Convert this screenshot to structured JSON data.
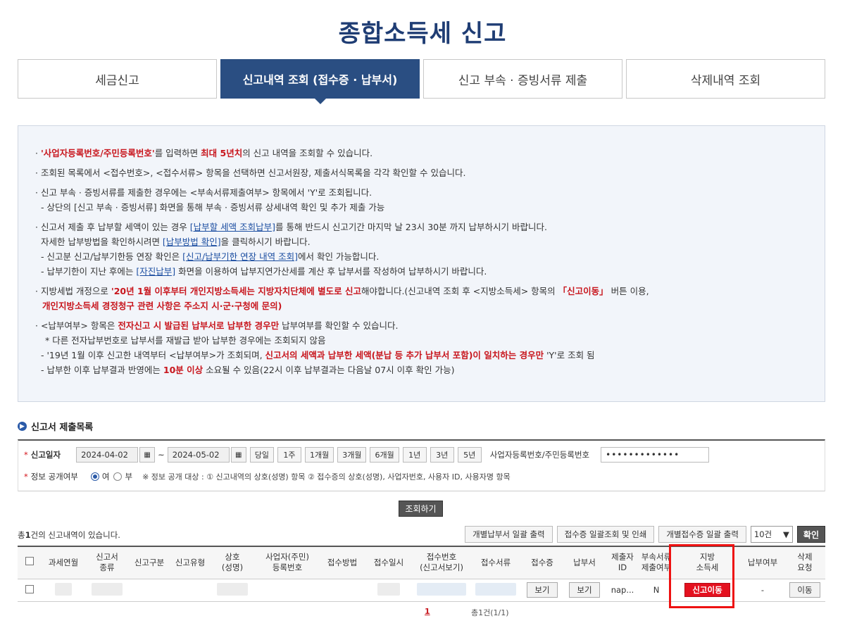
{
  "page": {
    "title": "종합소득세 신고"
  },
  "tabs": [
    {
      "label": "세금신고",
      "active": false
    },
    {
      "label": "신고내역 조회 (접수증 · 납부서)",
      "active": true
    },
    {
      "label": "신고 부속 · 증빙서류 제출",
      "active": false
    },
    {
      "label": "삭제내역 조회",
      "active": false
    }
  ],
  "notice": {
    "l1": {
      "a": "'사업자등록번호/주민등록번호'",
      "b": "를 입력하면 ",
      "c": "최대 5년치",
      "d": "의 신고 내역을 조회할 수 있습니다."
    },
    "l2": "· 조회된 목록에서 <접수번호>, <접수서류> 항목을 선택하면 신고서원장, 제출서식목록을 각각 확인할 수 있습니다.",
    "l3": "· 신고 부속 · 증빙서류를 제출한 경우에는 <부속서류제출여부> 항목에서 'Y'로 조회됩니다.",
    "l4": "- 상단의 [신고 부속 · 증빙서류] 화면을 통해 부속 · 증빙서류 상세내역 확인 및 추가 제출 가능",
    "l5": {
      "a": "· 신고서 제출 후 납부할 세액이 있는 경우 ",
      "link": "[납부할 세액 조회납부]",
      "b": "를 통해 반드시 신고기간 마지막 날 23시 30분 까지 납부하시기 바랍니다."
    },
    "l6": {
      "a": "자세한 납부방법을 확인하시려면 ",
      "link": "[납부방법 확인]",
      "b": "을 클릭하시기 바랍니다."
    },
    "l7": {
      "a": "- 신고분 신고/납부기한등 연장 확인은 ",
      "link": "[신고/납부기한 연장 내역 조회]",
      "b": "에서 확인 가능합니다."
    },
    "l8": {
      "a": "- 납부기한이 지난 후에는 ",
      "link": "[자진납부]",
      "b": " 화면을 이용하여 납부지연가산세를 계산 후 납부서를 작성하여 납부하시기 바랍니다."
    },
    "l9": {
      "a": "· 지방세법 개정으로 ",
      "b": "'20년 1월 이후부터 개인지방소득세는 지방자치단체에 별도로 신고",
      "c": "해야합니다.(신고내역 조회 후 <지방소득세> 항목의 ",
      "d": "「신고이동」",
      "e": " 버튼 이용,"
    },
    "l10": "개인지방소득세 경정청구 관련 사항은 주소지 시·군·구청에 문의)",
    "l11": {
      "a": "· <납부여부> 항목은 ",
      "b": "전자신고 시 발급된 납부서로 납부한 경우만",
      "c": " 납부여부를 확인할 수 있습니다."
    },
    "l12": "* 다른 전자납부번호로 납부서를 재발급 받아 납부한 경우에는 조회되지 않음",
    "l13": {
      "a": "- '19년 1월 이후 신고한 내역부터 <납부여부>가 조회되며, ",
      "b": "신고서의 세액과 납부한 세액(분납 등 추가 납부서 포함)이 일치하는 경우만",
      "c": " 'Y'로 조회 됨"
    },
    "l14": {
      "a": "- 납부한 이후 납부결과 반영에는 ",
      "b": "10분 이상",
      "c": " 소요될 수 있음(22시 이후 납부결과는 다음날 07시 이후 확인 가능)"
    }
  },
  "section": {
    "title": "신고서 제출목록"
  },
  "search": {
    "date_label": "신고일자",
    "date_from": "2024-04-02",
    "date_sep": "~",
    "date_to": "2024-05-02",
    "periods": [
      "당일",
      "1주",
      "1개월",
      "3개월",
      "6개월",
      "1년",
      "3년",
      "5년"
    ],
    "id_label": "사업자등록번호/주민등록번호",
    "id_value": "•••••••••••••",
    "public_label": "정보 공개여부",
    "radio_yes": "여",
    "radio_no": "부",
    "public_note": "※ 정보 공개 대상 : ① 신고내역의 상호(성명) 항목 ② 접수증의 상호(성명), 사업자번호, 사용자 ID, 사용자명 항목",
    "query_button": "조회하기"
  },
  "results": {
    "count_pre": "총",
    "count_num": "1",
    "count_post": "건의 신고내역이 있습니다.",
    "btn_print_payment": "개별납부서 일괄 출력",
    "btn_receipt_print": "접수증 일괄조회 및 인쇄",
    "btn_receipt_each": "개별접수증 일괄 출력",
    "page_size": "10건",
    "confirm": "확인"
  },
  "table": {
    "headers": [
      "과세연월",
      "신고서\n종류",
      "신고구분",
      "신고유형",
      "상호\n(성명)",
      "사업자(주민)\n등록번호",
      "접수방법",
      "접수일시",
      "접수번호\n(신고서보기)",
      "접수서류",
      "접수증",
      "납부서",
      "제출자\nID",
      "부속서류\n제출여부",
      "지방\n소득세",
      "납부여부",
      "삭제\n요청"
    ],
    "row": {
      "receipt_btn": "보기",
      "payment_btn": "보기",
      "submitter_id": "nap...",
      "attach_flag": "N",
      "local_tax_btn": "신고이동",
      "paid": "-",
      "move_btn": "이동"
    }
  },
  "paging": {
    "current": "1",
    "total": "총1건(1/1)"
  },
  "colors": {
    "brand": "#2a4e82",
    "title": "#1f3d74",
    "alert": "#c8161d",
    "highlight": "#e11111"
  }
}
